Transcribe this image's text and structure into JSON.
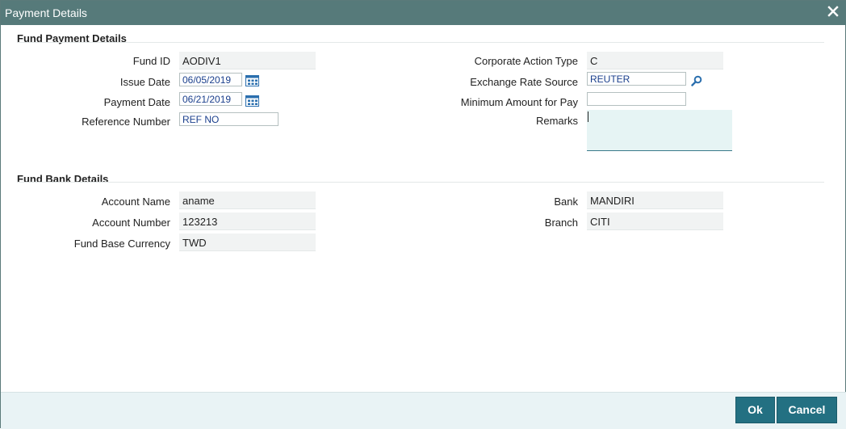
{
  "window": {
    "title": "Payment Details"
  },
  "fund_payment": {
    "heading": "Fund Payment Details",
    "fund_id": {
      "label": "Fund ID",
      "value": "AODIV1"
    },
    "issue_date": {
      "label": "Issue Date",
      "value": "06/05/2019"
    },
    "payment_date": {
      "label": "Payment Date",
      "value": "06/21/2019"
    },
    "reference_number": {
      "label": "Reference Number",
      "value": "REF NO"
    },
    "corporate_action_type": {
      "label": "Corporate Action Type",
      "value": "C"
    },
    "exchange_rate_source": {
      "label": "Exchange Rate Source",
      "value": "REUTER"
    },
    "minimum_amount": {
      "label": "Minimum Amount for Pay",
      "value": ""
    },
    "remarks": {
      "label": "Remarks",
      "value": ""
    }
  },
  "fund_bank": {
    "heading": "Fund Bank Details",
    "account_name": {
      "label": "Account Name",
      "value": "aname"
    },
    "account_number": {
      "label": "Account Number",
      "value": "123213"
    },
    "fund_base_currency": {
      "label": "Fund Base Currency",
      "value": "TWD"
    },
    "bank": {
      "label": "Bank",
      "value": "MANDIRI"
    },
    "branch": {
      "label": "Branch",
      "value": "CITI"
    }
  },
  "buttons": {
    "ok": "Ok",
    "cancel": "Cancel"
  },
  "icons": {
    "close": "close-icon",
    "calendar": "calendar-icon",
    "lookup": "search-icon"
  },
  "colors": {
    "titlebar": "#567a7a",
    "button": "#237082",
    "footer": "#e9f3f5",
    "input_text": "#1a3f8c"
  }
}
